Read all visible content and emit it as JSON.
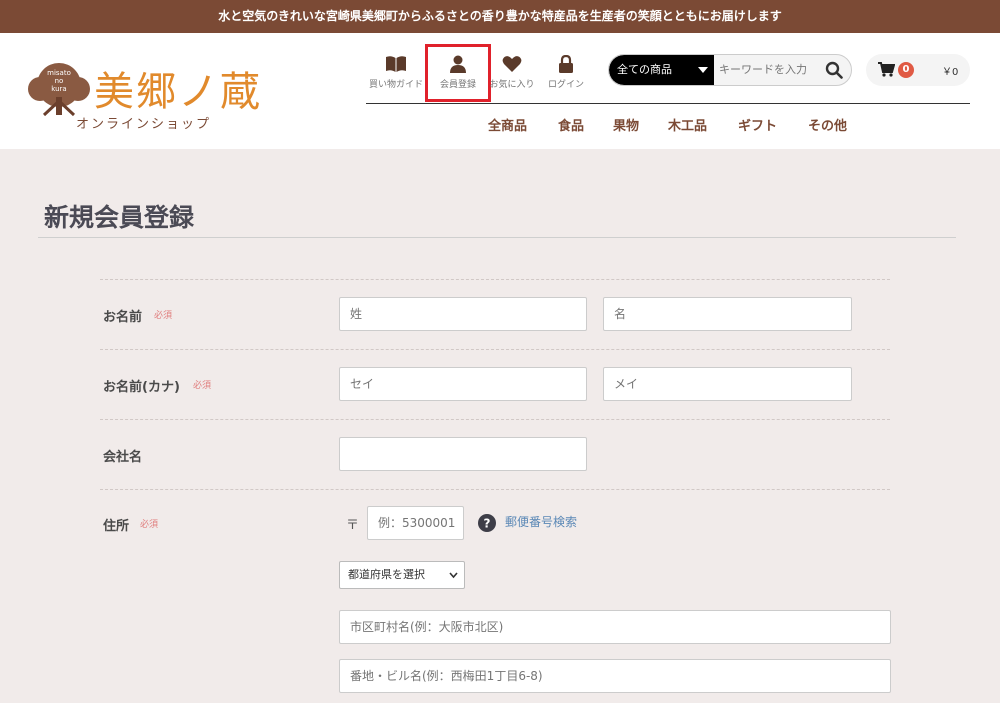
{
  "banner": {
    "text": "水と空気のきれいな宮崎県美郷町からふるさとの香り豊かな特産品を生産者の笑顔とともにお届けします"
  },
  "logo": {
    "brand": "美郷ノ蔵",
    "sub": "オンラインショップ",
    "tree_text": [
      "misato",
      "no",
      "kura"
    ]
  },
  "icon_nav": [
    {
      "label": "買い物ガイド",
      "icon": "book-icon"
    },
    {
      "label": "会員登録",
      "icon": "user-icon",
      "active": true
    },
    {
      "label": "お気に入り",
      "icon": "heart-icon"
    },
    {
      "label": "ログイン",
      "icon": "lock-icon"
    }
  ],
  "search": {
    "category": "全ての商品",
    "placeholder": "キーワードを入力"
  },
  "cart": {
    "count": "0",
    "total": "￥0"
  },
  "categories": [
    "全商品",
    "食品",
    "果物",
    "木工品",
    "ギフト",
    "その他"
  ],
  "page_title": "新規会員登録",
  "form": {
    "required": "必須",
    "name": {
      "label": "お名前",
      "last_placeholder": "姓",
      "first_placeholder": "名"
    },
    "kana": {
      "label": "お名前(カナ)",
      "last_placeholder": "セイ",
      "first_placeholder": "メイ"
    },
    "company": {
      "label": "会社名"
    },
    "address": {
      "label": "住所",
      "postal_mark": "〒",
      "postal_placeholder": "例：5300001",
      "postal_lookup": "郵便番号検索",
      "prefecture_select": "都道府県を選択",
      "city_placeholder": "市区町村名(例：大阪市北区)",
      "street_placeholder": "番地・ビル名(例：西梅田1丁目6-8)"
    }
  },
  "colors": {
    "banner": "#7b4a35",
    "brand": "#e18a2c",
    "accent_red": "#e0212b",
    "link": "#5b88b6"
  }
}
